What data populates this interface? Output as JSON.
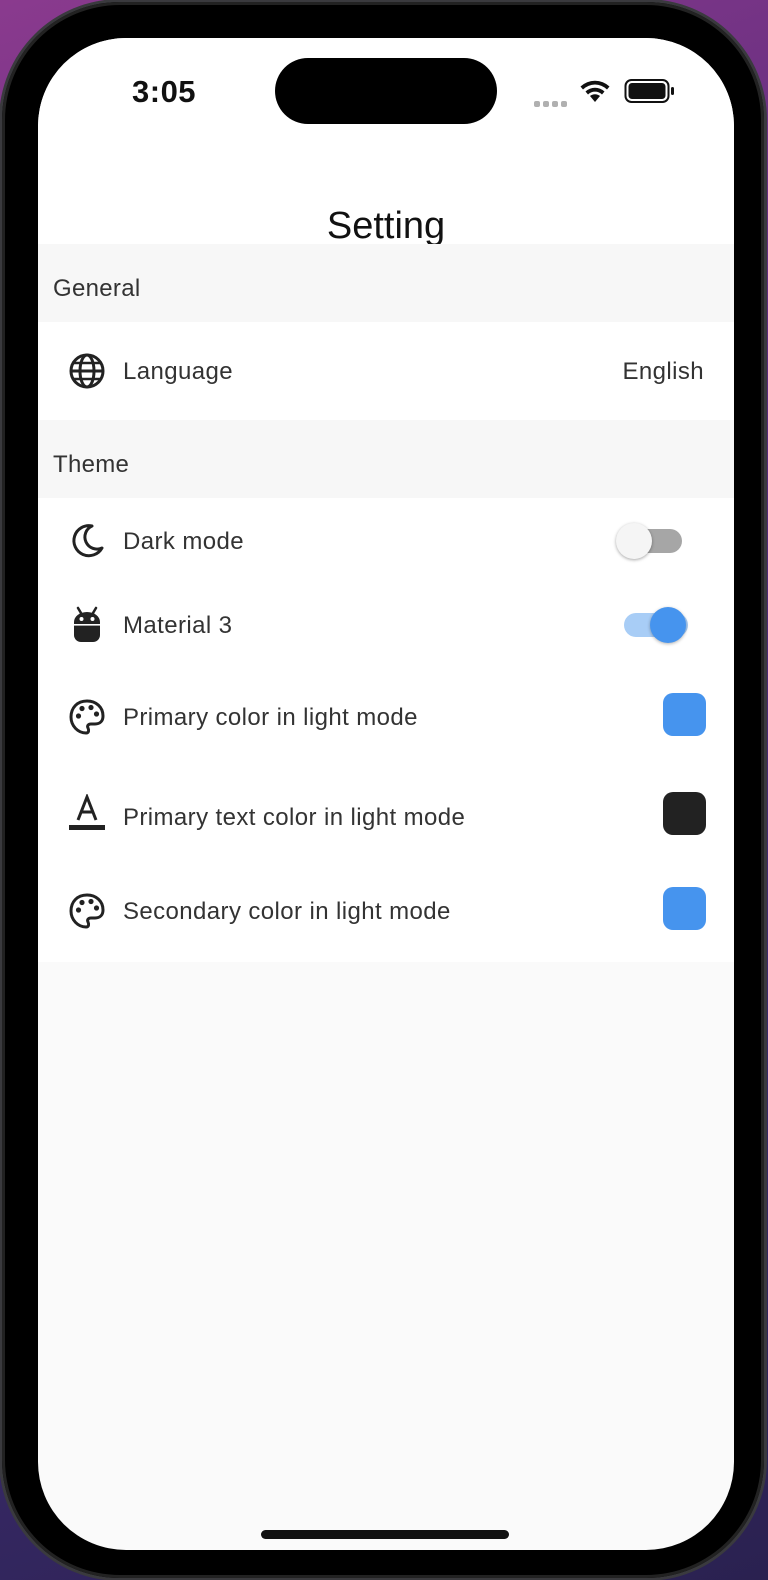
{
  "status_bar": {
    "time": "3:05"
  },
  "app_bar": {
    "title": "Setting"
  },
  "sections": {
    "general": {
      "header": "General",
      "language": {
        "label": "Language",
        "value": "English"
      }
    },
    "theme": {
      "header": "Theme",
      "dark_mode": {
        "label": "Dark mode",
        "on": false
      },
      "material3": {
        "label": "Material 3",
        "on": true
      },
      "primary_color": {
        "label": "Primary color in light mode",
        "color": "#4694ee"
      },
      "primary_text_color": {
        "label": "Primary text color in light mode",
        "color": "#222222"
      },
      "secondary_color": {
        "label": "Secondary color in light mode",
        "color": "#4694ee"
      }
    }
  },
  "icons": {
    "language": "globe-icon",
    "dark_mode": "moon-icon",
    "material3": "android-icon",
    "primary_color": "palette-icon",
    "primary_text_color": "text-color-icon",
    "secondary_color": "palette-icon"
  },
  "colors": {
    "accent": "#4694ee",
    "switch_off_track": "#a6a6a6"
  }
}
